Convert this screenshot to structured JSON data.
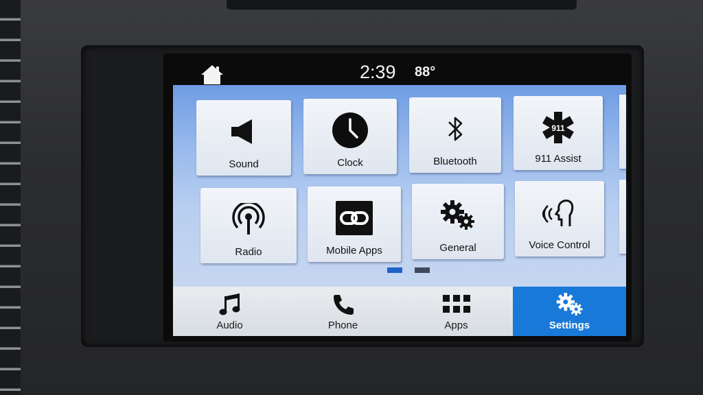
{
  "status": {
    "time": "2:39",
    "temperature": "88°"
  },
  "tiles": [
    {
      "label": "Sound",
      "icon": "speaker-icon"
    },
    {
      "label": "Clock",
      "icon": "clock-icon"
    },
    {
      "label": "Bluetooth",
      "icon": "bluetooth-icon"
    },
    {
      "label": "911 Assist",
      "icon": "emergency-star-icon",
      "badge": "911"
    },
    {
      "label": "Radio",
      "icon": "radio-antenna-icon"
    },
    {
      "label": "Mobile Apps",
      "icon": "link-icon"
    },
    {
      "label": "General",
      "icon": "gears-icon"
    },
    {
      "label": "Voice Control",
      "icon": "voice-head-icon"
    }
  ],
  "pagination": {
    "current_page": 1,
    "total_pages": 2
  },
  "tabs": [
    {
      "label": "Audio",
      "icon": "music-note-icon",
      "active": false
    },
    {
      "label": "Phone",
      "icon": "phone-handset-icon",
      "active": false
    },
    {
      "label": "Apps",
      "icon": "grid-icon",
      "active": false
    },
    {
      "label": "Settings",
      "icon": "gears-icon",
      "active": true
    }
  ],
  "colors": {
    "accent_blue": "#1979d8",
    "page_dot_active": "#1f63c6",
    "background_sky": "#97b9ec"
  }
}
